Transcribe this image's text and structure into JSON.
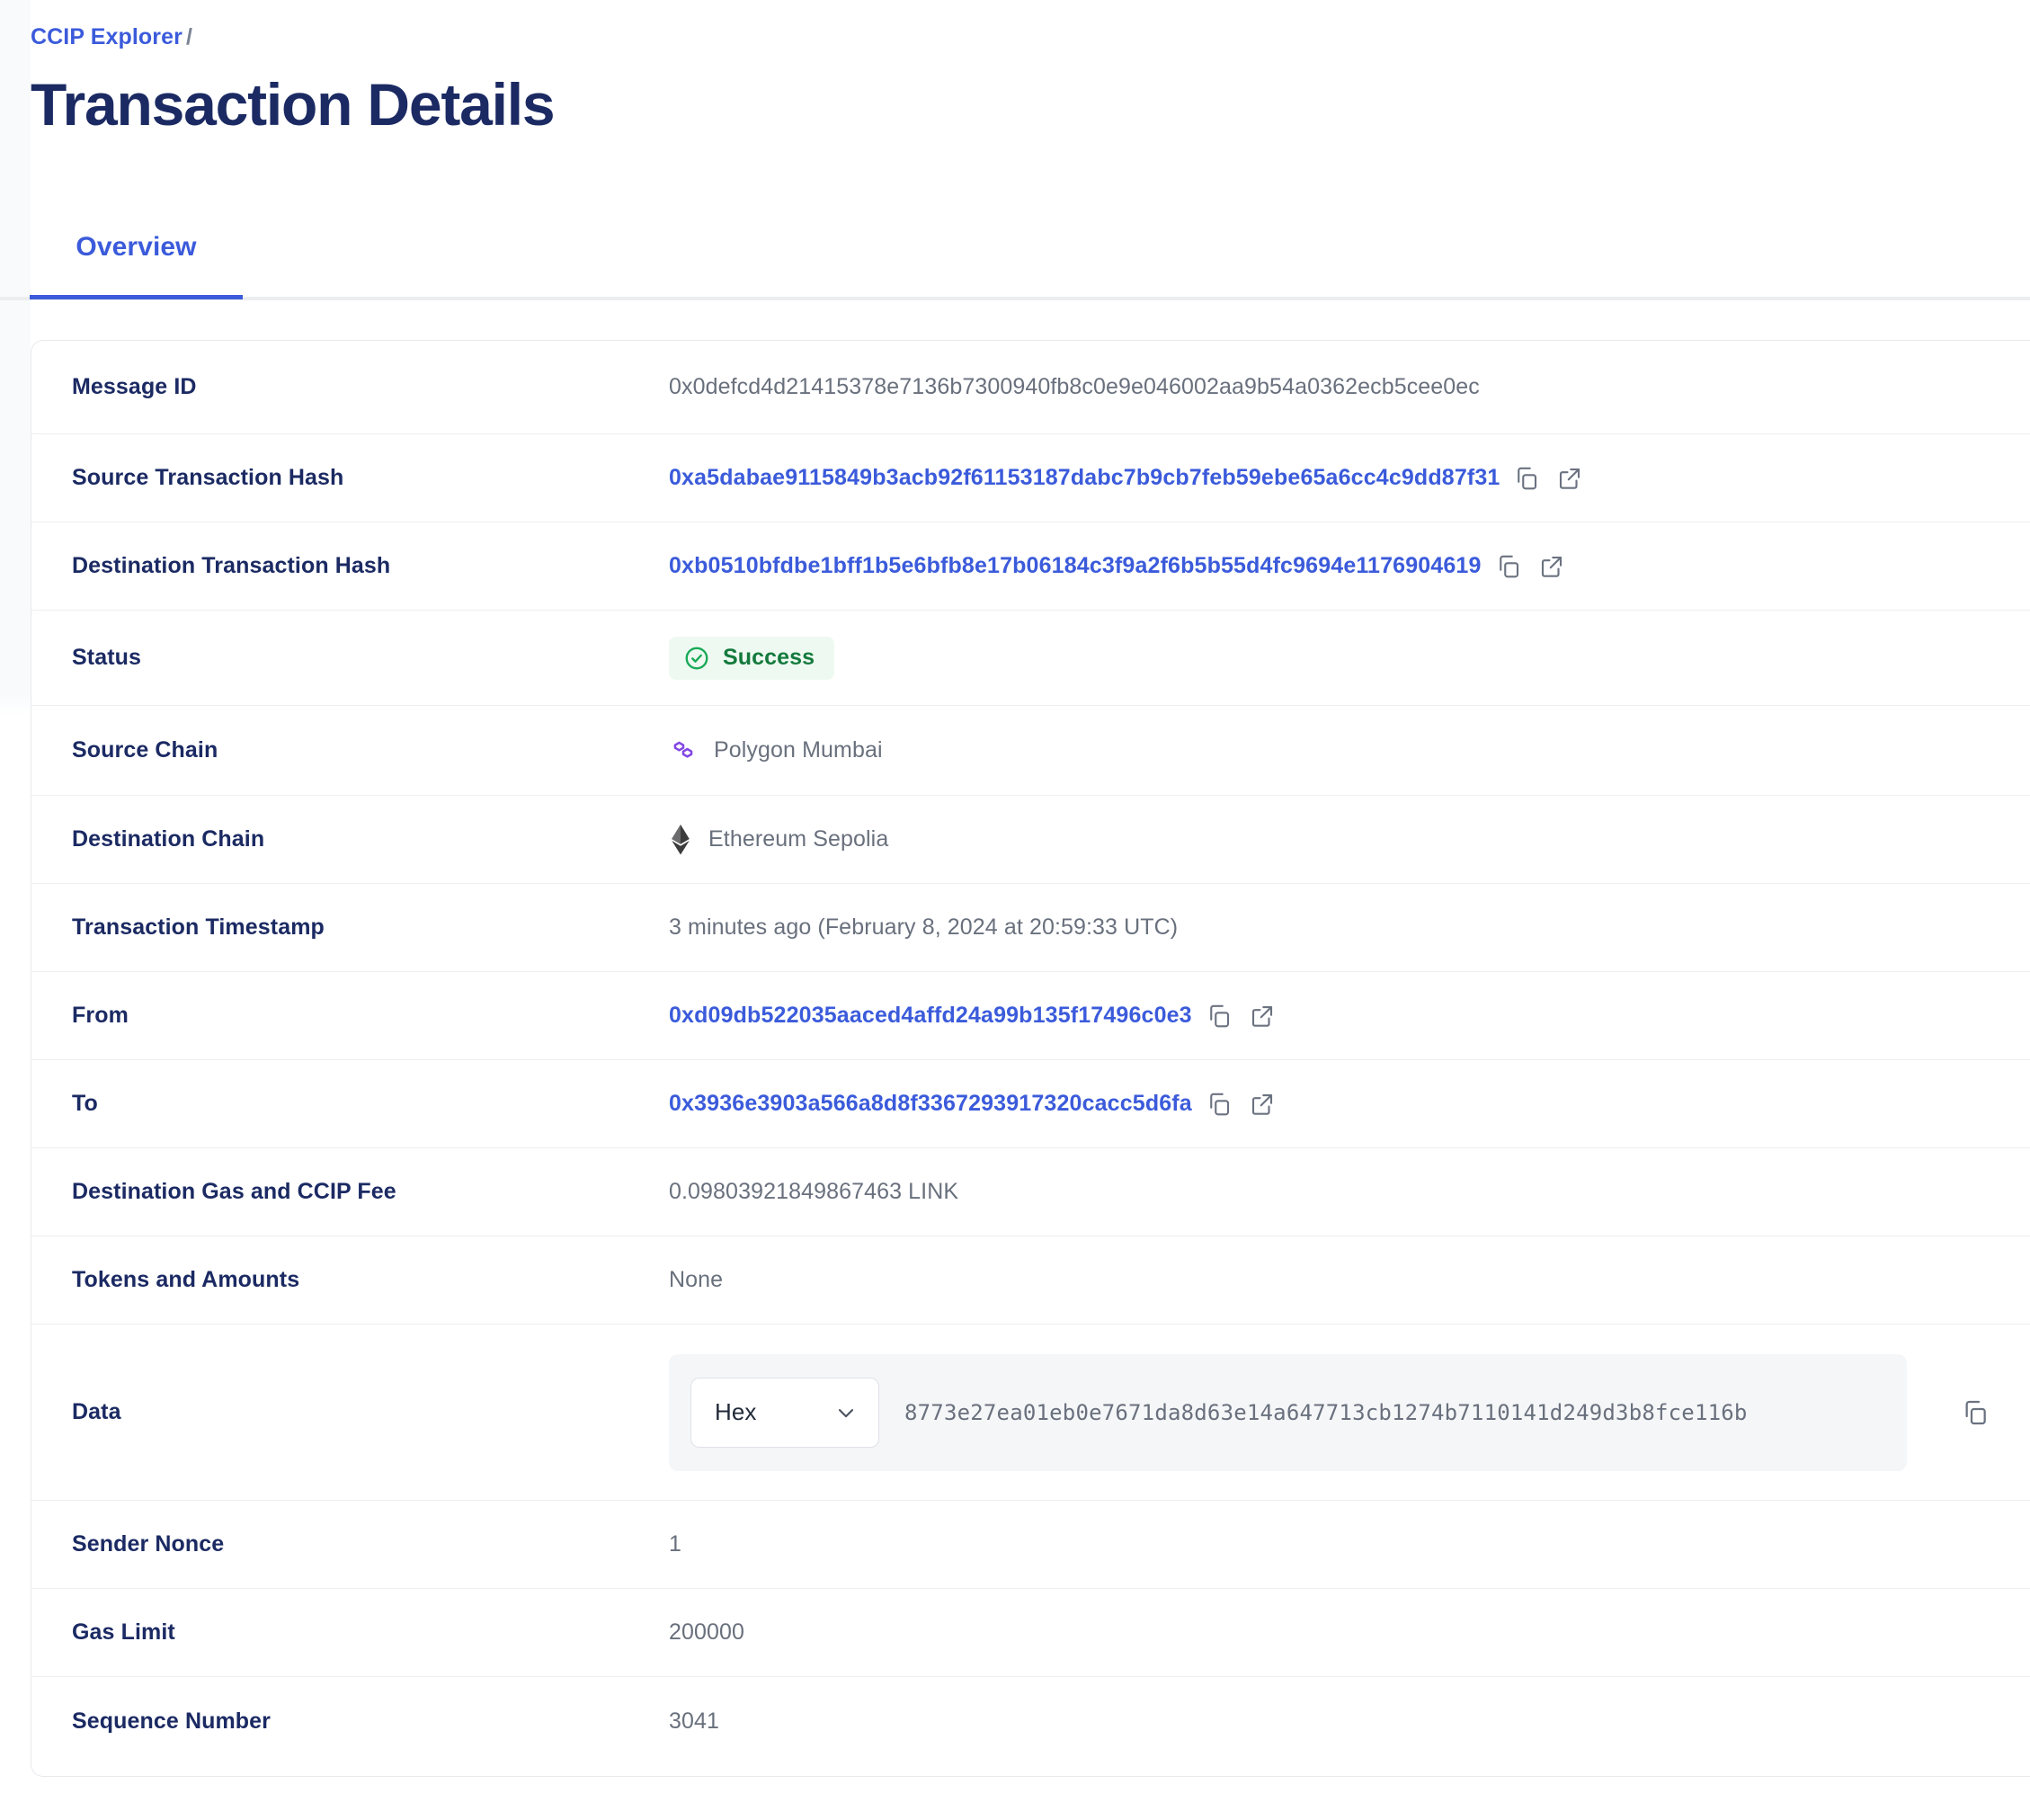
{
  "breadcrumb": {
    "parent": "CCIP Explorer",
    "separator": "/"
  },
  "page_title": "Transaction Details",
  "tabs": [
    {
      "label": "Overview",
      "active": true
    }
  ],
  "colors": {
    "accent_blue": "#3b5bdb",
    "title_navy": "#1b2a63",
    "value_gray": "#69707d",
    "success_green": "#147a3d",
    "success_bg": "#eefaf1",
    "polygon_purple": "#8247e5",
    "ethereum_dark": "#3c3c3d",
    "panel_bg": "#f5f6f8"
  },
  "rows": {
    "message_id": {
      "label": "Message ID",
      "value": "0x0defcd4d21415378e7136b7300940fb8c0e9e046002aa9b54a0362ecb5cee0ec"
    },
    "source_tx_hash": {
      "label": "Source Transaction Hash",
      "value": "0xa5dabae9115849b3acb92f61153187dabc7b9cb7feb59ebe65a6cc4c9dd87f31"
    },
    "destination_tx_hash": {
      "label": "Destination Transaction Hash",
      "value": "0xb0510bfdbe1bff1b5e6bfb8e17b06184c3f9a2f6b5b55d4fc9694e1176904619"
    },
    "status": {
      "label": "Status",
      "value": "Success",
      "icon": "check-circle-icon"
    },
    "source_chain": {
      "label": "Source Chain",
      "value": "Polygon Mumbai",
      "icon": "polygon-icon"
    },
    "destination_chain": {
      "label": "Destination Chain",
      "value": "Ethereum Sepolia",
      "icon": "ethereum-icon"
    },
    "timestamp": {
      "label": "Transaction Timestamp",
      "value": "3 minutes ago (February 8, 2024 at 20:59:33 UTC)"
    },
    "from": {
      "label": "From",
      "value": "0xd09db522035aaced4affd24a99b135f17496c0e3"
    },
    "to": {
      "label": "To",
      "value": "0x3936e3903a566a8d8f3367293917320cacc5d6fa"
    },
    "fee": {
      "label": "Destination Gas and CCIP Fee",
      "value": "0.09803921849867463 LINK"
    },
    "tokens": {
      "label": "Tokens and Amounts",
      "value": "None"
    },
    "data": {
      "label": "Data",
      "format_selected": "Hex",
      "format_options": [
        "Hex"
      ],
      "value": "8773e27ea01eb0e7671da8d63e14a647713cb1274b7110141d249d3b8fce116b"
    },
    "sender_nonce": {
      "label": "Sender Nonce",
      "value": "1"
    },
    "gas_limit": {
      "label": "Gas Limit",
      "value": "200000"
    },
    "sequence_number": {
      "label": "Sequence Number",
      "value": "3041"
    }
  },
  "icons": {
    "copy": "copy-icon",
    "external_link": "external-link-icon",
    "chevron_down": "chevron-down-icon"
  }
}
